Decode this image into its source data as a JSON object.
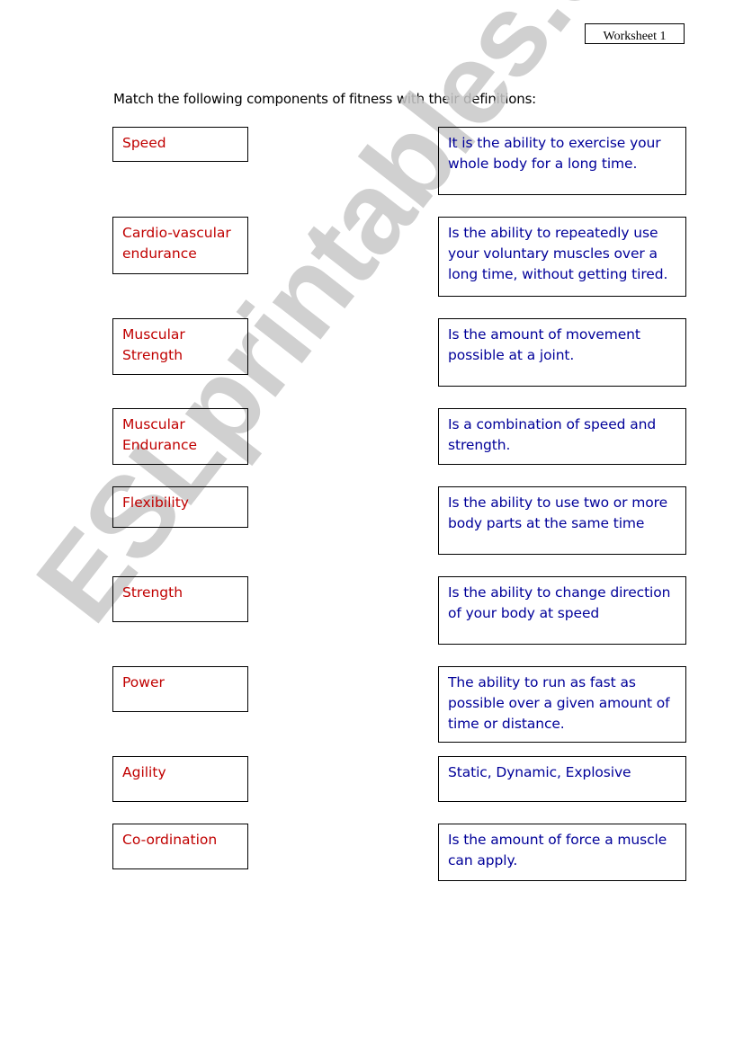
{
  "worksheet_label": "Worksheet 1",
  "instructions": "Match the following components of fitness with their definitions:",
  "watermark": "ESLprintables.com",
  "colors": {
    "term_text": "#c00000",
    "definition_text": "#000099",
    "watermark": "#c8c8c8"
  },
  "terms": [
    "Speed",
    "Cardio-vascular endurance",
    "Muscular Strength",
    "Muscular Endurance",
    "Flexibility",
    "Strength",
    "Power",
    "Agility",
    "Co-ordination"
  ],
  "definitions": [
    "It is the ability to exercise your whole body for a long time.",
    "Is the ability to repeatedly use your voluntary muscles over a long time, without getting tired.",
    "Is the amount of movement possible at a joint.",
    "Is a combination of speed and strength.",
    "Is the ability to use two or more body parts at the same time",
    "Is the ability to change direction of your body at speed",
    "The ability to run as fast as possible over a given amount of time or distance.",
    "Static, Dynamic, Explosive",
    "Is the amount of force a muscle can apply."
  ]
}
